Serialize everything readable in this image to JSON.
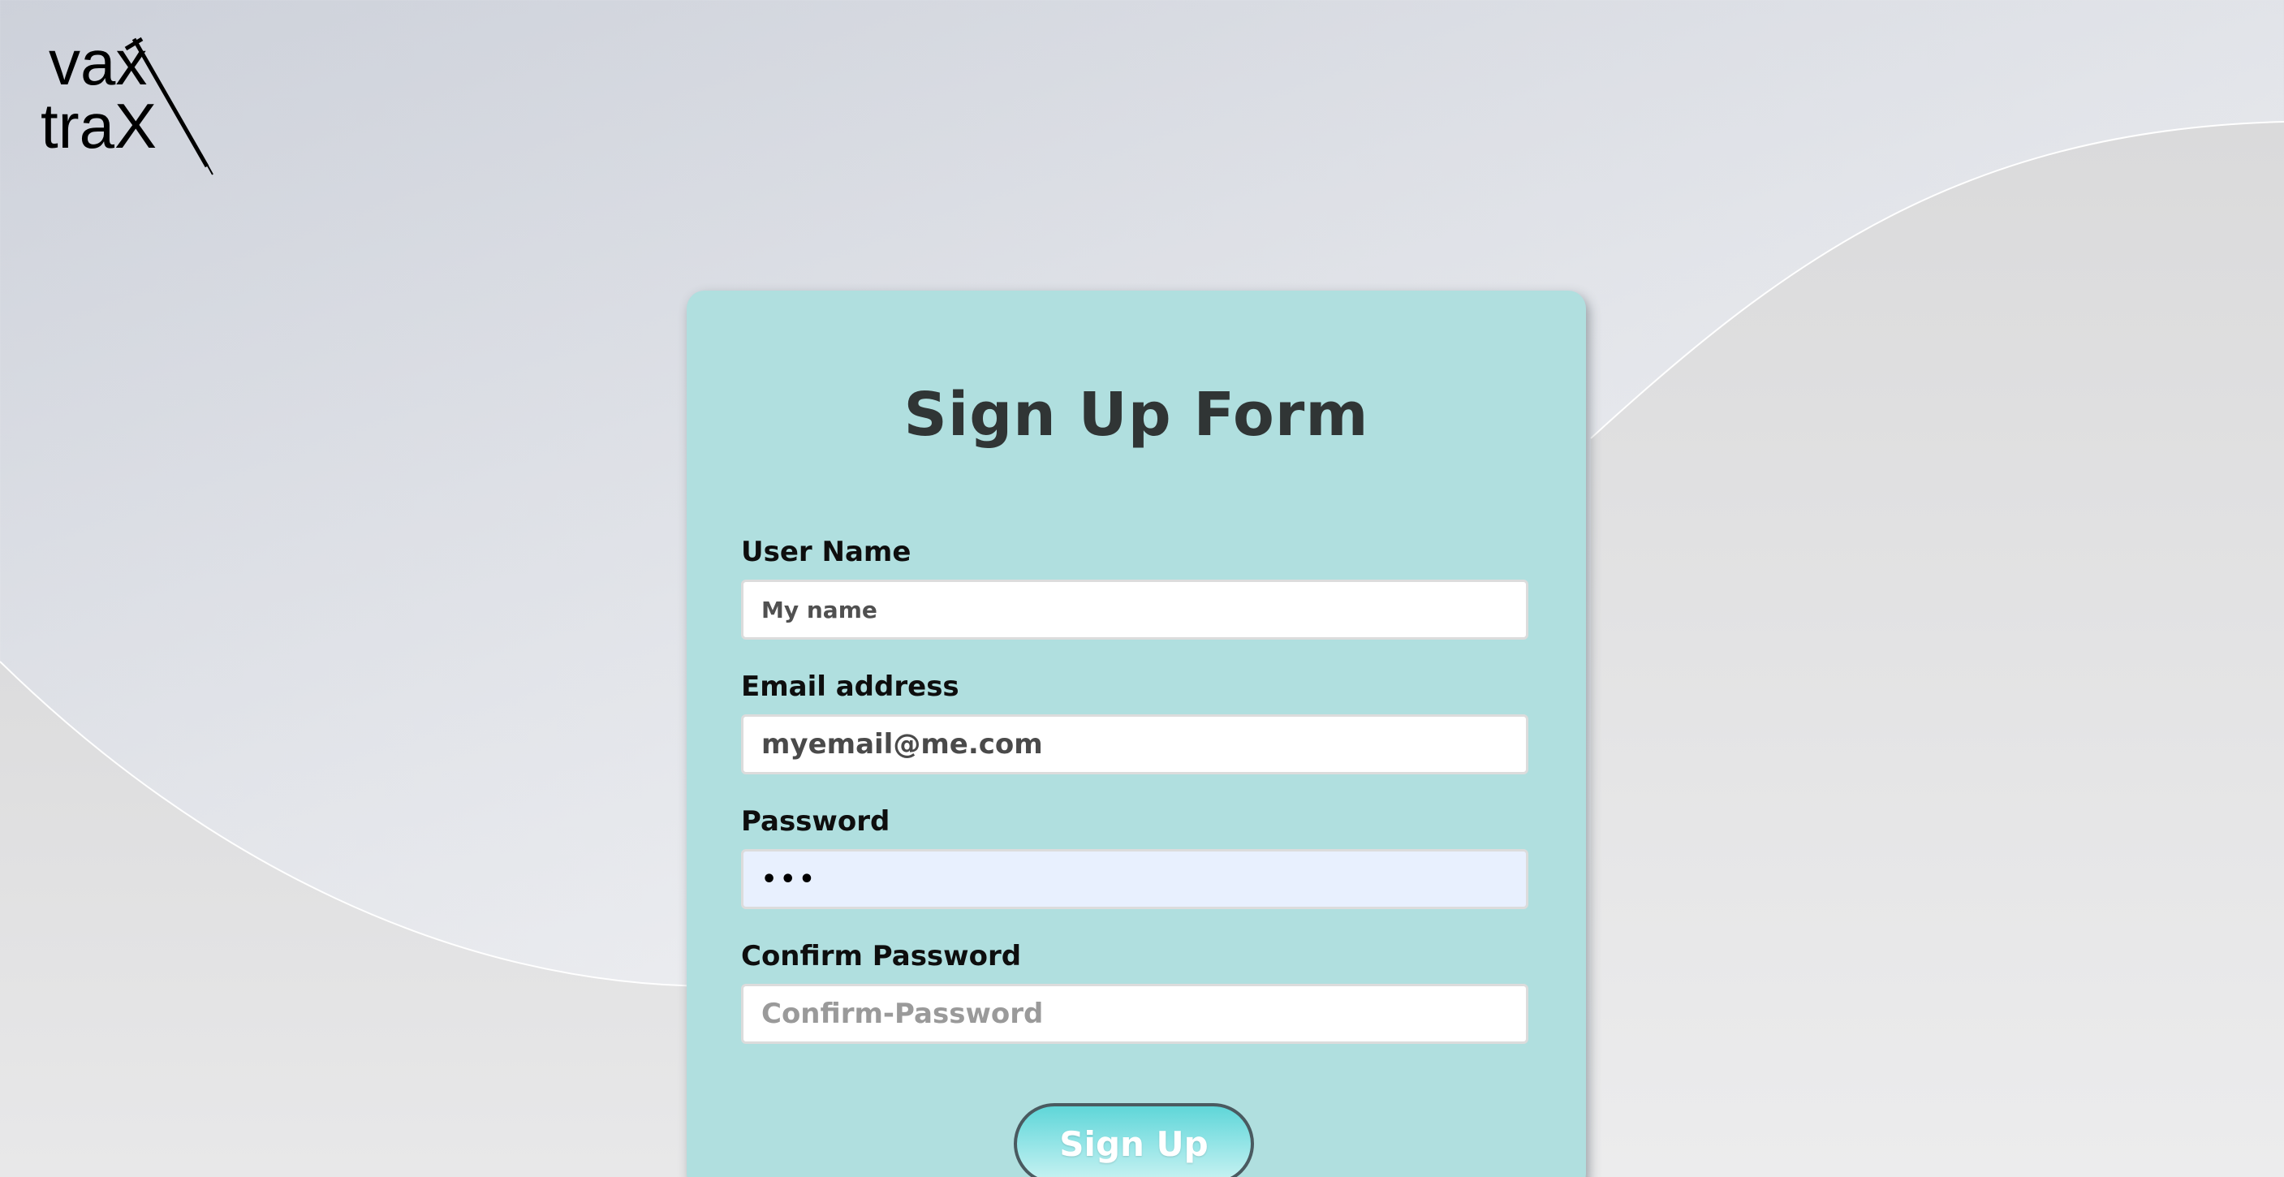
{
  "brand": {
    "logo_line1": "vax",
    "logo_line2": "traX"
  },
  "form": {
    "title": "Sign Up Form",
    "fields": {
      "username": {
        "label": "User Name",
        "placeholder": "My name",
        "value": ""
      },
      "email": {
        "label": "Email address",
        "placeholder": "",
        "value": "myemail@me.com"
      },
      "password": {
        "label": "Password",
        "placeholder": "",
        "value": "•••"
      },
      "confirm_password": {
        "label": "Confirm Password",
        "placeholder": "Confirm-Password",
        "value": ""
      }
    },
    "submit_label": "Sign Up"
  },
  "colors": {
    "card_background": "#b0dfdf",
    "title_text": "#303535",
    "autofill_background": "#e8f0fe",
    "button_gradient_top": "#5fd6d8",
    "button_border": "#4a5a60"
  }
}
